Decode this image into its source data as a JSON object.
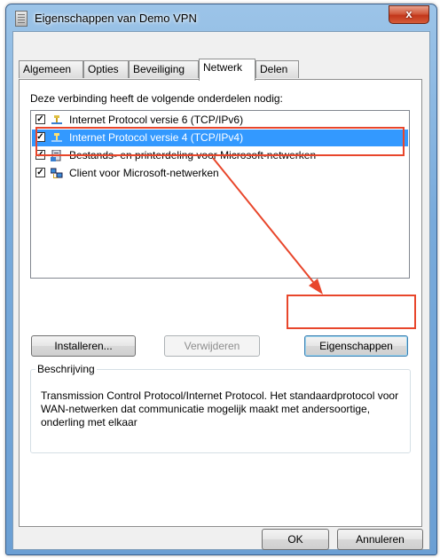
{
  "window": {
    "title": "Eigenschappen van Demo VPN",
    "close_glyph": "x",
    "icon": "document-icon"
  },
  "tabs": [
    {
      "label": "Algemeen",
      "active": false
    },
    {
      "label": "Opties",
      "active": false
    },
    {
      "label": "Beveiliging",
      "active": false
    },
    {
      "label": "Netwerk",
      "active": true
    },
    {
      "label": "Delen",
      "active": false
    }
  ],
  "panel": {
    "heading": "Deze verbinding heeft de volgende onderdelen nodig:"
  },
  "components": [
    {
      "label": "Internet Protocol versie 6 (TCP/IPv6)",
      "checked": true,
      "selected": false,
      "icon": "network-protocol-icon"
    },
    {
      "label": "Internet Protocol versie 4 (TCP/IPv4)",
      "checked": true,
      "selected": true,
      "icon": "network-protocol-icon"
    },
    {
      "label": "Bestands- en printerdeling voor Microsoft-netwerken",
      "checked": true,
      "selected": false,
      "icon": "printer-sharing-icon"
    },
    {
      "label": "Client voor Microsoft-netwerken",
      "checked": true,
      "selected": false,
      "icon": "network-client-icon"
    }
  ],
  "buttons": {
    "install": "Installeren...",
    "remove": "Verwijderen",
    "properties": "Eigenschappen",
    "ok": "OK",
    "cancel": "Annuleren"
  },
  "description": {
    "title": "Beschrijving",
    "text": "Transmission Control Protocol/Internet Protocol. Het standaardprotocol voor WAN-netwerken dat communicatie mogelijk maakt met andersoortige, onderling met elkaar"
  },
  "annotation": {
    "color": "#e8462b"
  }
}
